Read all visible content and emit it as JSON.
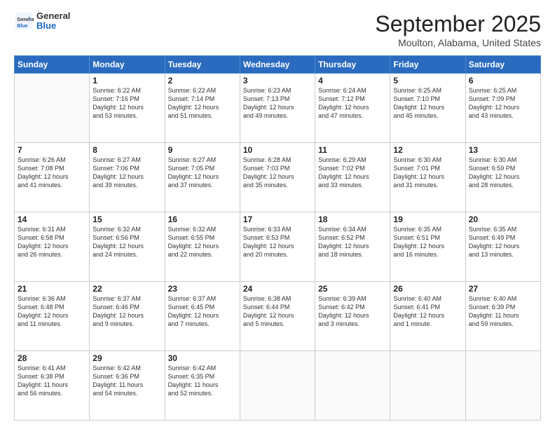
{
  "logo": {
    "line1": "General",
    "line2": "Blue"
  },
  "title": "September 2025",
  "location": "Moulton, Alabama, United States",
  "days_header": [
    "Sunday",
    "Monday",
    "Tuesday",
    "Wednesday",
    "Thursday",
    "Friday",
    "Saturday"
  ],
  "weeks": [
    [
      {
        "num": "",
        "text": ""
      },
      {
        "num": "1",
        "text": "Sunrise: 6:22 AM\nSunset: 7:16 PM\nDaylight: 12 hours\nand 53 minutes."
      },
      {
        "num": "2",
        "text": "Sunrise: 6:22 AM\nSunset: 7:14 PM\nDaylight: 12 hours\nand 51 minutes."
      },
      {
        "num": "3",
        "text": "Sunrise: 6:23 AM\nSunset: 7:13 PM\nDaylight: 12 hours\nand 49 minutes."
      },
      {
        "num": "4",
        "text": "Sunrise: 6:24 AM\nSunset: 7:12 PM\nDaylight: 12 hours\nand 47 minutes."
      },
      {
        "num": "5",
        "text": "Sunrise: 6:25 AM\nSunset: 7:10 PM\nDaylight: 12 hours\nand 45 minutes."
      },
      {
        "num": "6",
        "text": "Sunrise: 6:25 AM\nSunset: 7:09 PM\nDaylight: 12 hours\nand 43 minutes."
      }
    ],
    [
      {
        "num": "7",
        "text": "Sunrise: 6:26 AM\nSunset: 7:08 PM\nDaylight: 12 hours\nand 41 minutes."
      },
      {
        "num": "8",
        "text": "Sunrise: 6:27 AM\nSunset: 7:06 PM\nDaylight: 12 hours\nand 39 minutes."
      },
      {
        "num": "9",
        "text": "Sunrise: 6:27 AM\nSunset: 7:05 PM\nDaylight: 12 hours\nand 37 minutes."
      },
      {
        "num": "10",
        "text": "Sunrise: 6:28 AM\nSunset: 7:03 PM\nDaylight: 12 hours\nand 35 minutes."
      },
      {
        "num": "11",
        "text": "Sunrise: 6:29 AM\nSunset: 7:02 PM\nDaylight: 12 hours\nand 33 minutes."
      },
      {
        "num": "12",
        "text": "Sunrise: 6:30 AM\nSunset: 7:01 PM\nDaylight: 12 hours\nand 31 minutes."
      },
      {
        "num": "13",
        "text": "Sunrise: 6:30 AM\nSunset: 6:59 PM\nDaylight: 12 hours\nand 28 minutes."
      }
    ],
    [
      {
        "num": "14",
        "text": "Sunrise: 6:31 AM\nSunset: 6:58 PM\nDaylight: 12 hours\nand 26 minutes."
      },
      {
        "num": "15",
        "text": "Sunrise: 6:32 AM\nSunset: 6:56 PM\nDaylight: 12 hours\nand 24 minutes."
      },
      {
        "num": "16",
        "text": "Sunrise: 6:32 AM\nSunset: 6:55 PM\nDaylight: 12 hours\nand 22 minutes."
      },
      {
        "num": "17",
        "text": "Sunrise: 6:33 AM\nSunset: 6:53 PM\nDaylight: 12 hours\nand 20 minutes."
      },
      {
        "num": "18",
        "text": "Sunrise: 6:34 AM\nSunset: 6:52 PM\nDaylight: 12 hours\nand 18 minutes."
      },
      {
        "num": "19",
        "text": "Sunrise: 6:35 AM\nSunset: 6:51 PM\nDaylight: 12 hours\nand 16 minutes."
      },
      {
        "num": "20",
        "text": "Sunrise: 6:35 AM\nSunset: 6:49 PM\nDaylight: 12 hours\nand 13 minutes."
      }
    ],
    [
      {
        "num": "21",
        "text": "Sunrise: 6:36 AM\nSunset: 6:48 PM\nDaylight: 12 hours\nand 11 minutes."
      },
      {
        "num": "22",
        "text": "Sunrise: 6:37 AM\nSunset: 6:46 PM\nDaylight: 12 hours\nand 9 minutes."
      },
      {
        "num": "23",
        "text": "Sunrise: 6:37 AM\nSunset: 6:45 PM\nDaylight: 12 hours\nand 7 minutes."
      },
      {
        "num": "24",
        "text": "Sunrise: 6:38 AM\nSunset: 6:44 PM\nDaylight: 12 hours\nand 5 minutes."
      },
      {
        "num": "25",
        "text": "Sunrise: 6:39 AM\nSunset: 6:42 PM\nDaylight: 12 hours\nand 3 minutes."
      },
      {
        "num": "26",
        "text": "Sunrise: 6:40 AM\nSunset: 6:41 PM\nDaylight: 12 hours\nand 1 minute."
      },
      {
        "num": "27",
        "text": "Sunrise: 6:40 AM\nSunset: 6:39 PM\nDaylight: 11 hours\nand 59 minutes."
      }
    ],
    [
      {
        "num": "28",
        "text": "Sunrise: 6:41 AM\nSunset: 6:38 PM\nDaylight: 11 hours\nand 56 minutes."
      },
      {
        "num": "29",
        "text": "Sunrise: 6:42 AM\nSunset: 6:36 PM\nDaylight: 11 hours\nand 54 minutes."
      },
      {
        "num": "30",
        "text": "Sunrise: 6:42 AM\nSunset: 6:35 PM\nDaylight: 11 hours\nand 52 minutes."
      },
      {
        "num": "",
        "text": ""
      },
      {
        "num": "",
        "text": ""
      },
      {
        "num": "",
        "text": ""
      },
      {
        "num": "",
        "text": ""
      }
    ]
  ]
}
